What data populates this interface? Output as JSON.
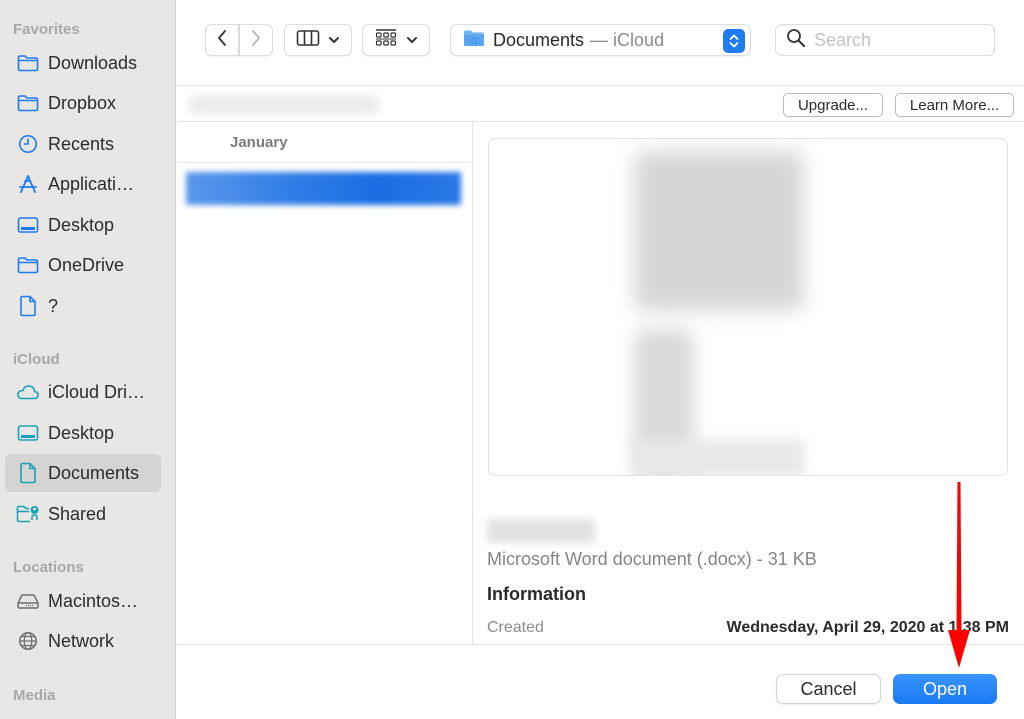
{
  "sidebar": {
    "sections": [
      {
        "title": "Favorites",
        "items": [
          {
            "label": "Downloads",
            "icon": "folder-icon"
          },
          {
            "label": "Dropbox",
            "icon": "folder-icon"
          },
          {
            "label": "Recents",
            "icon": "clock-icon"
          },
          {
            "label": "Applicati…",
            "icon": "applications-icon"
          },
          {
            "label": "Desktop",
            "icon": "desktop-icon"
          },
          {
            "label": "OneDrive",
            "icon": "folder-icon"
          },
          {
            "label": "?",
            "icon": "document-icon"
          }
        ]
      },
      {
        "title": "iCloud",
        "items": [
          {
            "label": "iCloud Dri…",
            "icon": "cloud-icon"
          },
          {
            "label": "Desktop",
            "icon": "desktop-icon"
          },
          {
            "label": "Documents",
            "icon": "document-icon",
            "selected": true
          },
          {
            "label": "Shared",
            "icon": "shared-folder-icon"
          }
        ]
      },
      {
        "title": "Locations",
        "items": [
          {
            "label": "Macintos…",
            "icon": "hard-drive-icon"
          },
          {
            "label": "Network",
            "icon": "globe-icon"
          }
        ]
      },
      {
        "title": "Media",
        "items": []
      }
    ]
  },
  "toolbar": {
    "location_name": "Documents",
    "location_sub": "— iCloud",
    "search_placeholder": "Search",
    "search_value": ""
  },
  "cloudbar": {
    "upgrade_label": "Upgrade...",
    "learn_more_label": "Learn More..."
  },
  "column": {
    "header": "January"
  },
  "preview": {
    "kind": "Microsoft Word document (.docx) - 31 KB",
    "info_title": "Information",
    "created_label": "Created",
    "created_value": "Wednesday, April 29, 2020 at 1:38 PM"
  },
  "footer": {
    "cancel_label": "Cancel",
    "open_label": "Open"
  },
  "colors": {
    "accent": "#1e7cf2",
    "sidebar_icon": "#1e7cf2",
    "icloud_icon": "#1aa3b8",
    "annotation_arrow": "#ff0000"
  }
}
